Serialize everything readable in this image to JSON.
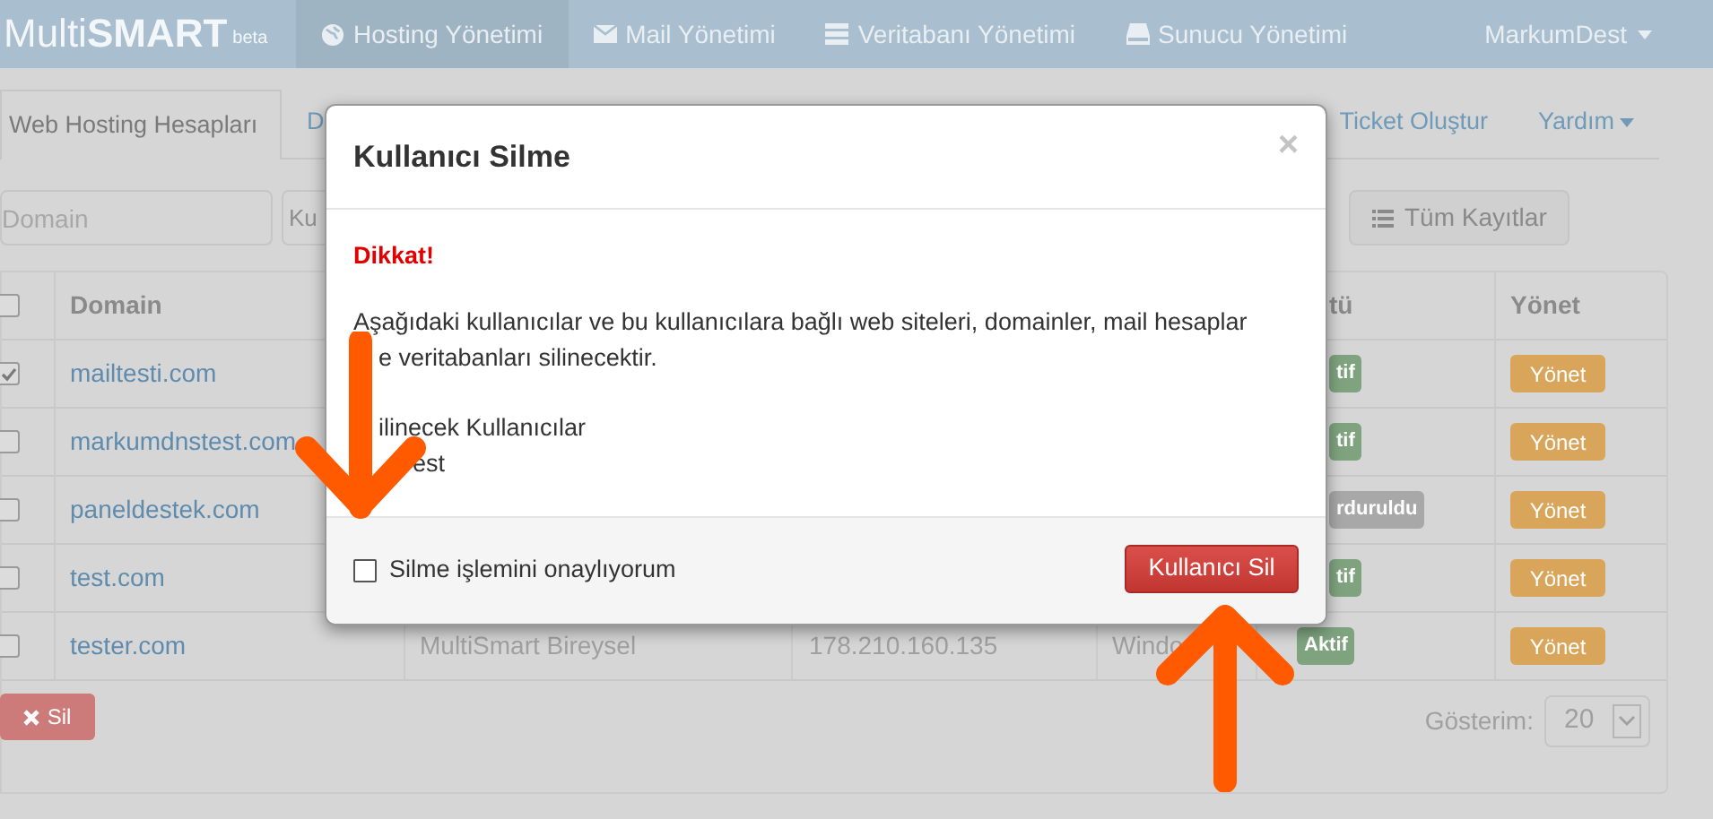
{
  "navbar": {
    "brand_light": "Multi",
    "brand_bold": "SMART",
    "badge": "beta",
    "items": [
      {
        "label": "Hosting Yönetimi",
        "kind": "globe",
        "selected": true
      },
      {
        "label": "Mail Yönetimi",
        "kind": "mail",
        "selected": false
      },
      {
        "label": "Veritabanı Yönetimi",
        "kind": "list",
        "selected": false
      },
      {
        "label": "Sunucu Yönetimi",
        "kind": "drive",
        "selected": false
      }
    ],
    "user": "MarkumDest"
  },
  "tabs": [
    {
      "label": "Web Hosting Hesapları",
      "selected": true,
      "dropdown": false
    },
    {
      "label": "D",
      "selected": false,
      "dropdown": false
    },
    {
      "label": "Ticket Oluştur",
      "selected": false,
      "dropdown": false
    },
    {
      "label": "Yardım",
      "selected": false,
      "dropdown": true
    }
  ],
  "filters": {
    "domain_placeholder": "Domain",
    "second_placeholder": "Ku",
    "all_button": "Tüm Kayıtlar"
  },
  "table": {
    "header_checked": false,
    "column_domain": "Domain",
    "column_status": "tü",
    "column_manage": "Yönet",
    "rows": [
      {
        "checked": true,
        "domain": "mailtesti.com",
        "status": "tif",
        "color": "#7fa37f",
        "manage": "Yönet"
      },
      {
        "checked": false,
        "domain": "markumdnstest.com",
        "status": "tif",
        "color": "#7fa37f",
        "manage": "Yönet"
      },
      {
        "checked": false,
        "domain": "paneldestek.com",
        "status": "rduruldu",
        "color": "#a8a8a8",
        "manage": "Yönet"
      },
      {
        "checked": false,
        "domain": "test.com",
        "status": "tif",
        "color": "#7fa37f",
        "manage": "Yönet"
      },
      {
        "checked": false,
        "domain": "tester.com",
        "package": "MultiSmart Bireysel",
        "ip": "178.210.160.135",
        "os": "Windo",
        "status": "Aktif",
        "color": "#7fa37f",
        "manage": "Yönet"
      }
    ]
  },
  "footer": {
    "delete_button": "Sil",
    "page_size_label": "Gösterim:",
    "page_size": "20"
  },
  "modal": {
    "title": "Kullanıcı Silme",
    "close": "×",
    "warning": "Dikkat!",
    "line_1": "Aşağıdaki kullanıcılar ve bu kullanıcılara bağlı web siteleri, domainler, mail hesaplar",
    "line_2": "e veritabanları silinecektir.",
    "list_title": "ilinecek Kullanıcılar",
    "list_item": "est",
    "confirm_checkbox": {
      "label": "Silme işlemini onaylıyorum",
      "checked": false
    },
    "confirm_button": "Kullanıcı Sil"
  }
}
